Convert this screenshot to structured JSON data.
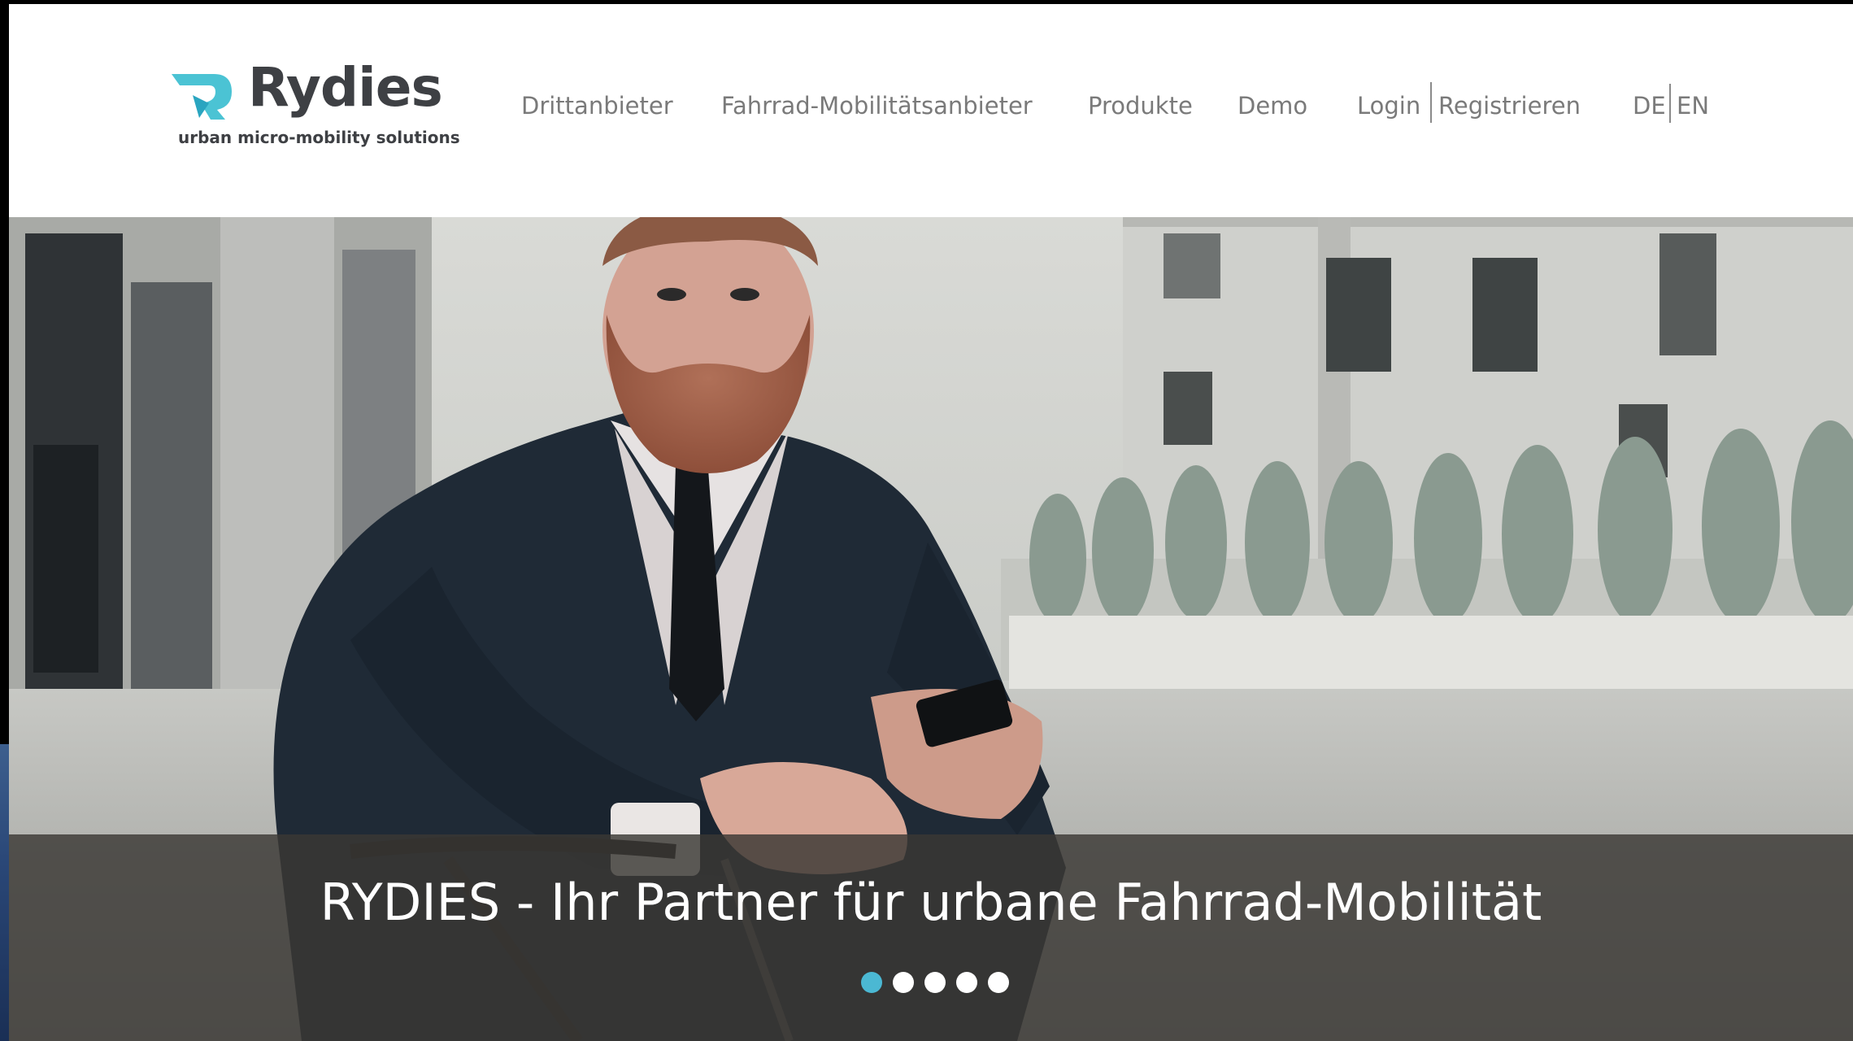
{
  "brand": {
    "name": "Rydies",
    "tagline": "urban micro-mobility solutions",
    "accent_color": "#4bc3d4",
    "text_color": "#3e4044"
  },
  "nav": {
    "items": [
      {
        "label": "Drittanbieter"
      },
      {
        "label": "Fahrrad-Mobilitätsanbieter"
      },
      {
        "label": "Produkte"
      },
      {
        "label": "Demo"
      },
      {
        "label": "Login"
      },
      {
        "label": "Registrieren"
      }
    ],
    "languages": [
      "DE",
      "EN"
    ]
  },
  "hero": {
    "caption": "RYDIES - Ihr Partner für urbane Fahrrad-Mobilität",
    "image_description_icon": "hero-photo",
    "slides_total": 5,
    "active_slide": 1,
    "active_dot_color": "#4bb8d3"
  }
}
